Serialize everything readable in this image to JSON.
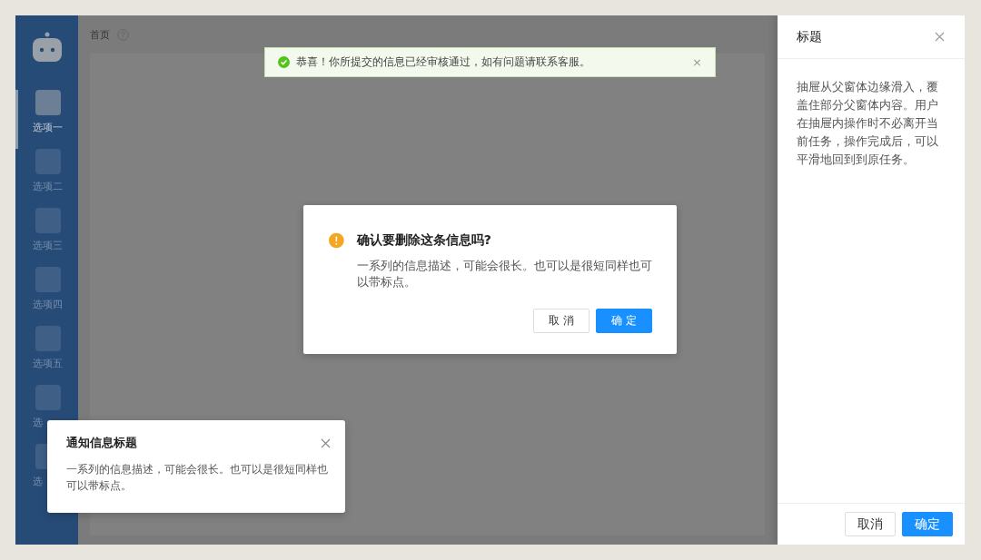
{
  "sidebar": {
    "items": [
      {
        "label": "选项一",
        "selected": true
      },
      {
        "label": "选项二",
        "selected": false
      },
      {
        "label": "选项三",
        "selected": false
      },
      {
        "label": "选项四",
        "selected": false
      },
      {
        "label": "选项五",
        "selected": false
      },
      {
        "label": "选",
        "selected": false
      },
      {
        "label": "选",
        "selected": false
      }
    ]
  },
  "breadcrumb": {
    "label": "首页"
  },
  "message": {
    "kind": "success",
    "text": "恭喜！你所提交的信息已经审核通过，如有问题请联系客服。",
    "close": "×"
  },
  "modal": {
    "kind": "warning",
    "title": "确认要删除这条信息吗?",
    "description": "一系列的信息描述，可能会很长。也可以是很短同样也可以带标点。",
    "buttons": [
      {
        "label": "取 消",
        "primary": false
      },
      {
        "label": "确 定",
        "primary": true
      }
    ]
  },
  "notification": {
    "title": "通知信息标题",
    "description": "一系列的信息描述，可能会很长。也可以是很短同样也可以带标点。"
  },
  "drawer": {
    "title": "标题",
    "body": "抽屉从父窗体边缘滑入，覆盖住部分父窗体内容。用户在抽屉内操作时不必离开当前任务，操作完成后，可以平滑地回到到原任务。",
    "buttons": [
      {
        "label": "取消",
        "primary": false
      },
      {
        "label": "确定",
        "primary": true
      }
    ]
  }
}
